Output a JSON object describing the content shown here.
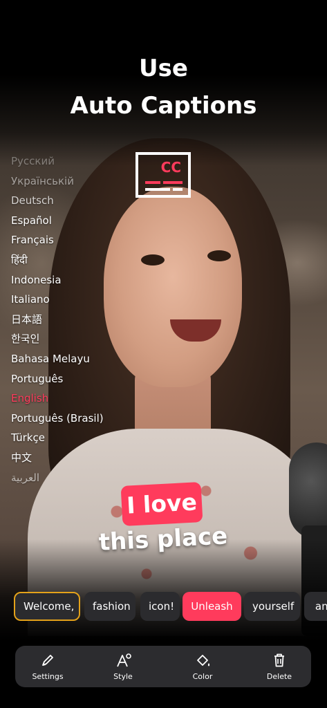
{
  "headline": {
    "line1": "Use",
    "line2": "Auto Captions"
  },
  "cc_icon": {
    "text": "CC",
    "accent_color": "#ff3b5c"
  },
  "languages": [
    "Русский",
    "Українській",
    "Deutsch",
    "Español",
    "Français",
    "हिंदी",
    "Indonesia",
    "Italiano",
    "日本語",
    "한국인",
    "Bahasa Melayu",
    "Português",
    "English",
    "Português (Brasil)",
    "Türkçe",
    "中文",
    "العربية"
  ],
  "selected_language": "English",
  "caption": {
    "line1": "I love",
    "line2": "this place"
  },
  "words": [
    {
      "label": "Welcome,",
      "state": "selected"
    },
    {
      "label": "fashion",
      "state": "normal"
    },
    {
      "label": "icon!",
      "state": "normal"
    },
    {
      "label": "Unleash",
      "state": "active"
    },
    {
      "label": "yourself",
      "state": "normal"
    },
    {
      "label": "and",
      "state": "normal"
    }
  ],
  "toolbar": {
    "settings_label": "Settings",
    "style_label": "Style",
    "color_label": "Color",
    "delete_label": "Delete"
  },
  "colors": {
    "accent": "#ff3b5c",
    "selection_border": "#e4a21a",
    "chip_bg": "#2b2b2e",
    "toolbar_bg": "#2c2c2f"
  }
}
